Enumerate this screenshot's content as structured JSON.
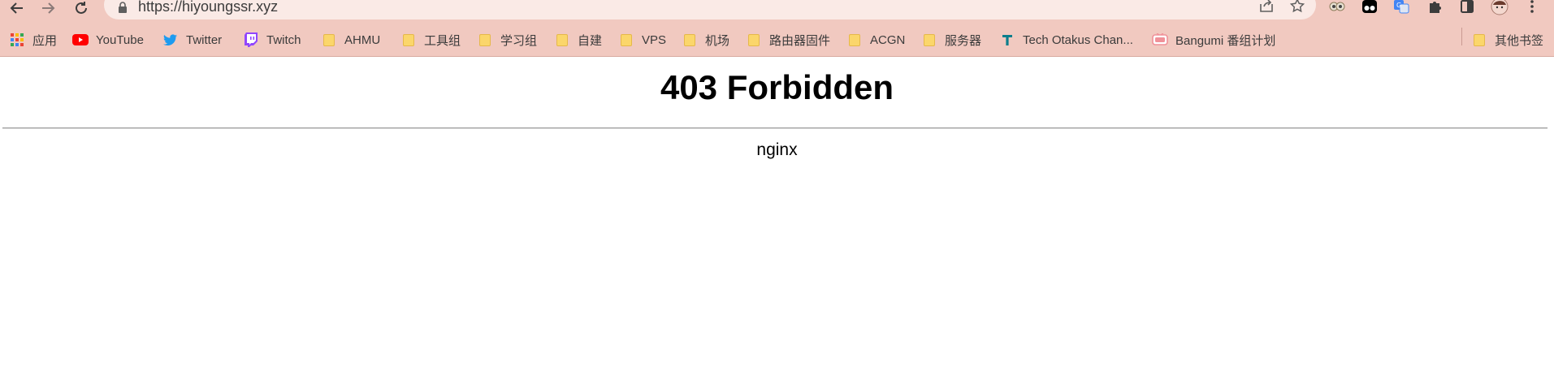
{
  "browser": {
    "url": "https://hiyoungssr.xyz",
    "nav_icons": [
      "back-arrow-icon",
      "forward-arrow-icon",
      "reload-icon"
    ],
    "omnibox_icons": [
      "share-icon",
      "star-icon"
    ],
    "extension_icons": [
      "owl-extension-icon",
      "tampermonkey-icon",
      "translate-icon",
      "puzzle-icon",
      "side-panel-icon",
      "avatar",
      "kebab-menu-icon"
    ],
    "colors": {
      "toolbar": "#f1c9c0",
      "omnibox": "#faeae6"
    }
  },
  "bookmarks": {
    "items": [
      {
        "label": "应用",
        "icon": "apps-grid-icon"
      },
      {
        "label": "YouTube",
        "icon": "youtube-icon"
      },
      {
        "label": "Twitter",
        "icon": "twitter-icon"
      },
      {
        "label": "Twitch",
        "icon": "twitch-icon"
      },
      {
        "label": "AHMU",
        "icon": "folder-icon"
      },
      {
        "label": "工具组",
        "icon": "folder-icon"
      },
      {
        "label": "学习组",
        "icon": "folder-icon"
      },
      {
        "label": "自建",
        "icon": "folder-icon"
      },
      {
        "label": "VPS",
        "icon": "folder-icon"
      },
      {
        "label": "机场",
        "icon": "folder-icon"
      },
      {
        "label": "路由器固件",
        "icon": "folder-icon"
      },
      {
        "label": "ACGN",
        "icon": "folder-icon"
      },
      {
        "label": "服务器",
        "icon": "folder-icon"
      },
      {
        "label": "Tech Otakus Chan...",
        "icon": "tech-otakus-icon"
      },
      {
        "label": "Bangumi 番组计划",
        "icon": "bangumi-icon"
      }
    ],
    "other": {
      "label": "其他书签",
      "icon": "folder-icon"
    }
  },
  "page": {
    "title": "403 Forbidden",
    "server": "nginx"
  }
}
